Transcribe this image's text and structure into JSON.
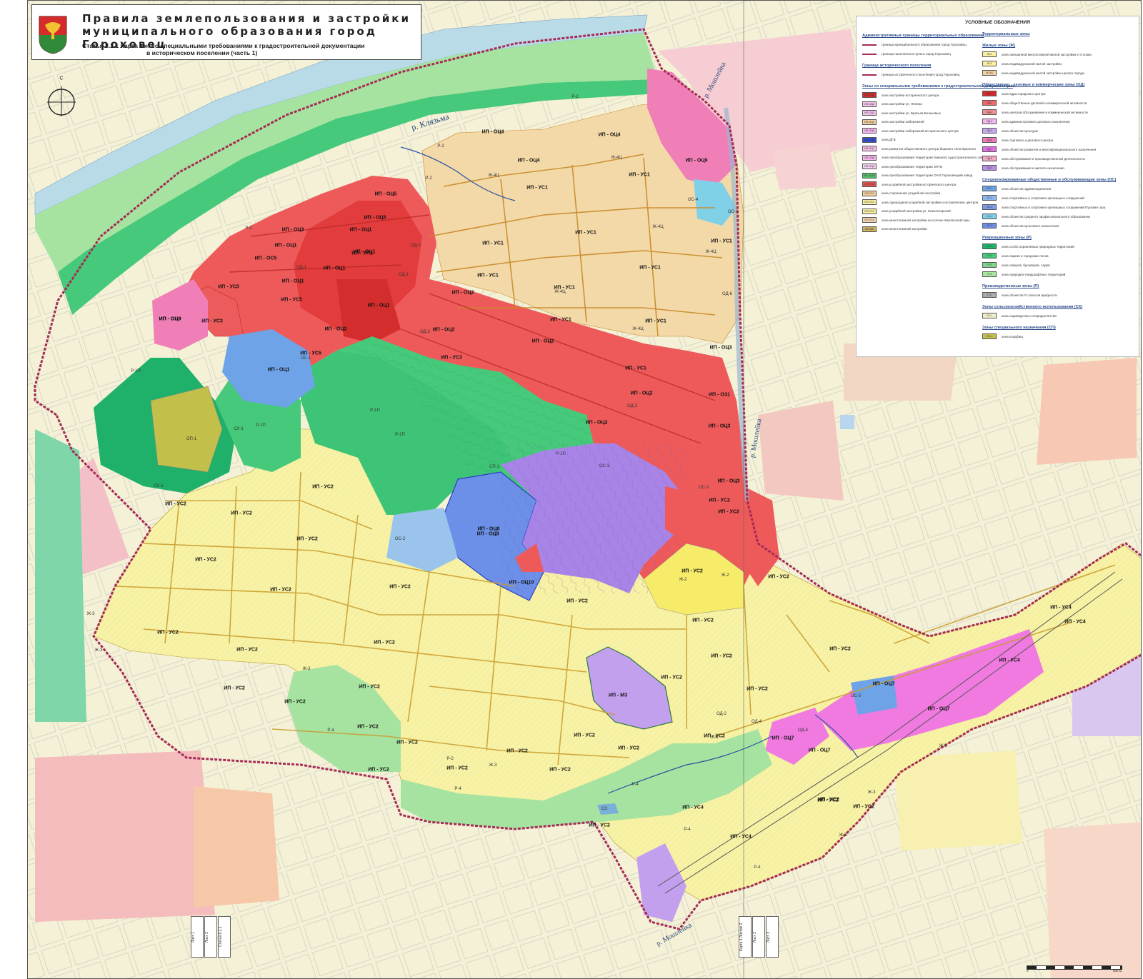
{
  "title": {
    "line1": "Правила землепользования и застройки",
    "line2": "муниципального образования город Гороховец",
    "subtitle_line1": "Статья 8.2.1 Карта зон со специальными требованиями к градостроительной документации",
    "subtitle_line2": "в историческом поселении (часть 1)"
  },
  "compass_label": "С",
  "rivers": [
    {
      "name": "р. Клязьма"
    },
    {
      "name": "р. Мошлейка"
    },
    {
      "name": "р. Мошлейка"
    },
    {
      "name": "р. Мошлейка"
    }
  ],
  "colors": {
    "residential": "#f7f2a6",
    "residential_estate": "#f3d8a8",
    "center_zone": "#f05a5a",
    "center_zone_dark": "#e03a3a",
    "mixed_zone": "#f08ab4",
    "mixed_violet": "#b68ae8",
    "special_blue": "#7fa8ea",
    "recreation_green": "#46c97a",
    "recreation_light": "#a8e6a0",
    "river_blue": "#b9d9ea",
    "historic_border": "#8a1f3f",
    "outside_bg_yellow": "#f7f3c8",
    "outside_bg_pink": "#f6c4c4"
  },
  "legend": {
    "title": "УСЛОВНЫЕ ОБОЗНАЧЕНИЯ",
    "left_sections": [
      {
        "heading": "Административные границы территориальных образований",
        "items": [
          {
            "code": "",
            "text": "граница муниципального образования город Гороховец"
          },
          {
            "code": "",
            "text": "граница населенного пункта город Гороховец"
          }
        ]
      },
      {
        "heading": "Граница исторического поселения",
        "items": [
          {
            "code": "",
            "text": "граница исторического поселения город Гороховец"
          }
        ]
      },
      {
        "heading": "Зоны со специальными требованиями к градостроительной документации",
        "items": [
          {
            "code": "ИП-ОЦ1",
            "text": "зона застройки исторического центра"
          },
          {
            "code": "ИП-ОЦ2",
            "text": "зона застройки ул. Ленина"
          },
          {
            "code": "ИП-ОЦ3",
            "text": "зона застройки ул. Братьев Бельковых"
          },
          {
            "code": "ИП-ОЦ4",
            "text": "зона застройки набережной"
          },
          {
            "code": "ИП-ОЦ5",
            "text": "зона застройки набережной исторического центра"
          },
          {
            "code": "ИП-ОЦ6",
            "text": "зона ДГБ"
          },
          {
            "code": "ИП-ОЦ7",
            "text": "зона развития общественного центра бывшего села Красного"
          },
          {
            "code": "ИП-ОЦ8",
            "text": "зона преобразования территории бывшего судостроительного завода"
          },
          {
            "code": "ИП-ОЦ9",
            "text": "зона преобразования территории ЗПТО"
          },
          {
            "code": "ИП-ОЦ10",
            "text": "зона преобразования территории ОАО Гороховецкий завод"
          },
          {
            "code": "ИП-УП1",
            "text": "зона усадебной застройки исторического центра"
          },
          {
            "code": "ИП-УС1",
            "text": "зона сохранения усадебной застройки"
          },
          {
            "code": "ИП-УС2",
            "text": "зона однородной усадебной застройки и исторических центров"
          },
          {
            "code": "ИП-УС3",
            "text": "зона усадебной застройки ул. Никологорской"
          },
          {
            "code": "ИП-УС4",
            "text": "зона многоэтажной застройки на склоне Никольской горы"
          },
          {
            "code": "ИП-М3",
            "text": "зона многоэтажной застройки"
          }
        ]
      }
    ],
    "right_sections": [
      {
        "heading": "Территориальные зоны",
        "items": []
      },
      {
        "heading": "Жилые зоны (Ж)",
        "items": [
          {
            "code": "Ж-2",
            "text": "зона смешанной многоэтажной жилой застройки 2-3 этажа"
          },
          {
            "code": "Ж-3",
            "text": "зона индивидуальной жилой застройки"
          },
          {
            "code": "Ж-4Ц",
            "text": "зона индивидуальной жилой застройки центра города"
          }
        ]
      },
      {
        "heading": "Общественно - деловые и коммерческие зоны (ОД)",
        "items": [
          {
            "code": "ОД-1",
            "text": "зона ядра городского центра"
          },
          {
            "code": "ОД-2",
            "text": "зона общественно-деловой и коммерческой активности"
          },
          {
            "code": "ОД-3",
            "text": "зона центров обслуживания и коммерческой активности"
          },
          {
            "code": "ОД-4",
            "text": "зона административно-делового назначения"
          },
          {
            "code": "ОД-5",
            "text": "зона объектов культуры"
          },
          {
            "code": "ОД-6",
            "text": "зона торгового и делового центра"
          },
          {
            "code": "ОД-7",
            "text": "зона объектов развития и многофункционального назначения"
          },
          {
            "code": "ОД-8",
            "text": "зона обслуживания и производственной деятельности"
          },
          {
            "code": "ОД-9",
            "text": "зона обслуживания и жилого назначения"
          }
        ]
      },
      {
        "heading": "Специализированные общественные и обслуживающие зоны (ОС)",
        "items": [
          {
            "code": "ОС-1",
            "text": "зона объектов здравоохранения"
          },
          {
            "code": "ОС-2",
            "text": "зона спортивных и спортивно-зрелищных сооружений"
          },
          {
            "code": "ОС-3",
            "text": "зона спортивных и спортивно-зрелищных сооружений Пуховая гора"
          },
          {
            "code": "ОС-4",
            "text": "зона объектов среднего профессионального образования"
          },
          {
            "code": "ОС-5",
            "text": "зона объектов культового назначения"
          }
        ]
      },
      {
        "heading": "Рекреационные зоны (Р)",
        "items": [
          {
            "code": "Р-1",
            "text": "зона особо охраняемых природных территорий"
          },
          {
            "code": "Р-2",
            "text": "зона парков и городских лесов"
          },
          {
            "code": "Р-3",
            "text": "зона скверов, бульваров, садов"
          },
          {
            "code": "Р-4",
            "text": "зона природно-ландшафтных территорий"
          }
        ]
      },
      {
        "heading": "Производственные зоны (П)",
        "items": [
          {
            "code": "П-1",
            "text": "зона объектов IV классов вредности"
          }
        ]
      },
      {
        "heading": "Зоны сельскохозяйственного использования (СХ)",
        "items": [
          {
            "code": "СХ-1",
            "text": "зона садоводства и огородничества"
          }
        ]
      },
      {
        "heading": "Зоны специального назначения (СП)",
        "items": [
          {
            "code": "СП-1",
            "text": "зона кладбищ"
          }
        ]
      }
    ]
  },
  "zone_labels": [
    "ИП - ОЦ4",
    "ИП - ОЦ4",
    "ИП - ОЦ5",
    "ИП - ОЦ5",
    "ИП - ОЦ1",
    "ИП - ОЦ3",
    "ИП - ОЦ1",
    "ИП - ОЦ1",
    "ИП - УП1",
    "ИП - ОС5",
    "ИП - ОЦ1",
    "ИП - ОЦ1",
    "ИП - УС5",
    "ИП - УС5",
    "ИП - ОЦ1",
    "ИП - ОЦ9",
    "ИП - УС3",
    "ИП - УС5",
    "ИП - ОЦ1",
    "ИП - ОЦ2",
    "ИП - ОЦ2",
    "ИП - УС3",
    "ИП - ОЦ2",
    "ИП - УС1",
    "ИП - ОЦ2",
    "ИП - ОЦ2",
    "ИП - ОЦ2",
    "ИП - ОЦ3",
    "ИП - ОЦ3",
    "ИП - ОЦ3",
    "ИП - ОЗ1",
    "ИП - ОЦ4",
    "ИП - УС1",
    "ИП - УС1",
    "ИП - УС1",
    "ИП - УС1",
    "ИП - УС1",
    "ИП - УС1",
    "ИП - УС1",
    "ИП - УС1",
    "ИП - УС1",
    "ИП - УС1",
    "ИП - ОЦ8",
    "ИП - УС2",
    "ИП - УС2",
    "ИП - УС2",
    "ИП - УС2",
    "ИП - УС2",
    "ИП - УС2",
    "ИП - УС2",
    "ИП - УС2",
    "ИП - УС2",
    "ИП - УС2",
    "ИП - УС2",
    "ИП - УС2",
    "ИП - УС2",
    "ИП - УС2",
    "ИП - УС2",
    "ИП - УС2",
    "ИП - УС2",
    "ИП - УС2",
    "ИП - УС2",
    "ИП - УС2",
    "ИП - УС2",
    "ИП - УС2",
    "ИП - УС2",
    "ИП - УС2",
    "ИП - УС2",
    "ИП - УС2",
    "ИП - ОЦ10",
    "ИП - М3",
    "ИП - УС2",
    "ИП - УС2",
    "ИП - УС2",
    "ИП - УС2",
    "ИП - УС4",
    "ИП - УС4",
    "ИП - УС4",
    "ИП - УС4",
    "ИП - УС4",
    "ИП - ОЦ7",
    "ИП - ОЦ7",
    "ИП - ОЦ7",
    "ИП - ОЦ7",
    "ИП - УС2",
    "ИП - УС2",
    "ИП - УС2",
    "ИП - УС2",
    "ИП - УС2",
    "ИП - УС2",
    "ИП - ОЦ6",
    "ИП - ОЦ9",
    "ИП - ОЦ9"
  ],
  "territorial_labels": [
    "Р-2",
    "Р-2",
    "Р-2",
    "Р-2",
    "Р-2",
    "ОД-1",
    "ОД-1",
    "ОД-1",
    "Ж-4Ц",
    "Ж-4Ц",
    "Ж-4Ц",
    "Ж-4Ц",
    "Ж-4Ц",
    "Ж-4Ц",
    "ОС-4",
    "ОС-2",
    "ОД-6",
    "ОД-2",
    "ОД-2",
    "ОС-1",
    "Р-1П",
    "Р-1П",
    "Р-1П",
    "Р-1П",
    "Р-1П",
    "СП-1",
    "ОС-2",
    "ОС-3",
    "ОС-3",
    "СХ-1",
    "СХ-1",
    "ОП-1",
    "Ж-2",
    "Ж-2",
    "Ж-3",
    "Ж-3",
    "Ж-3",
    "Ж-3",
    "Ж-3",
    "Ж-3",
    "Ж-3",
    "Ж-3",
    "Р-4",
    "Р-4",
    "Р-4",
    "Р-4",
    "Р-4",
    "ОЗ",
    "ОД-4",
    "ОС-5",
    "ОД-4",
    "ОД-2"
  ],
  "sheet_stamps": [
    "Лист 1",
    "Лист 2",
    "Статья 8.2.1",
    "Карта 1 Листов 2",
    "Лист 2",
    "Лист 3"
  ],
  "scale": {
    "left": "0",
    "right": "500 м"
  }
}
